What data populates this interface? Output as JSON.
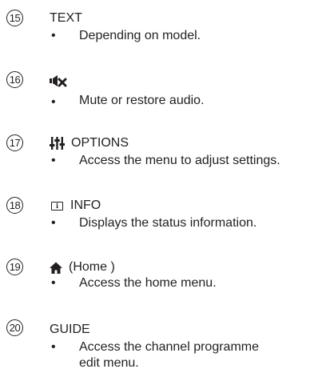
{
  "entries": [
    {
      "number": "15",
      "label": "TEXT",
      "icon": "",
      "description": "Depending on model."
    },
    {
      "number": "16",
      "label": "",
      "icon": "mute-icon",
      "description": "Mute or restore audio."
    },
    {
      "number": "17",
      "label": "OPTIONS",
      "icon": "options-sliders-icon",
      "description": "Access the menu to adjust settings."
    },
    {
      "number": "18",
      "label": "INFO",
      "icon": "info-icon",
      "icon_glyph": "i",
      "description": "Displays the status information."
    },
    {
      "number": "19",
      "label": "(Home )",
      "icon": "home-icon",
      "description": "Access the home menu."
    },
    {
      "number": "20",
      "label": "GUIDE",
      "icon": "",
      "description": "Access the channel programme edit menu.",
      "description_lines": [
        "Access the channel programme",
        "edit menu."
      ]
    }
  ],
  "bullet": "•"
}
